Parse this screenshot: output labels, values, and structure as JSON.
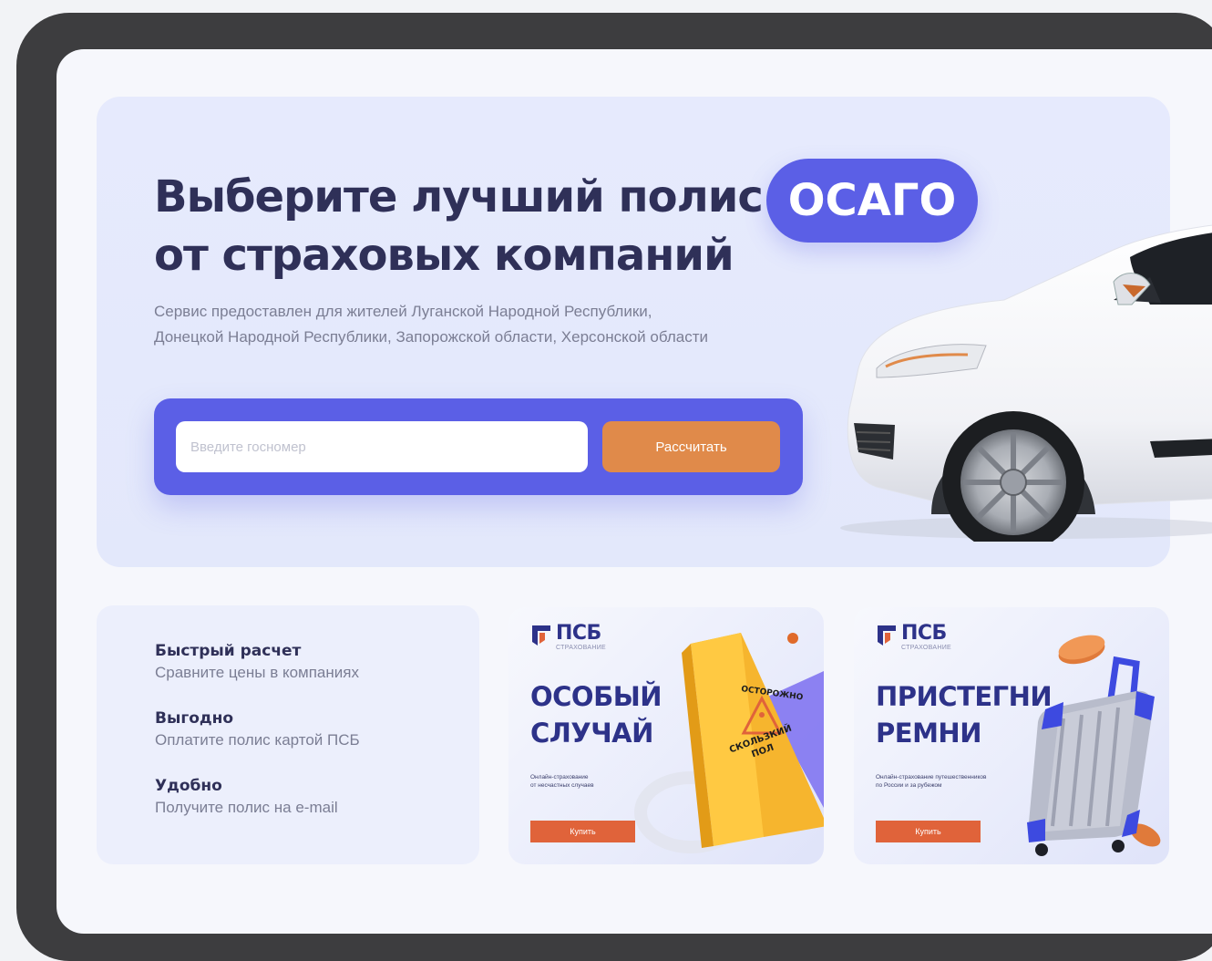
{
  "hero": {
    "title_line1": "Выберите лучший полис",
    "title_line2": "от страховых компаний",
    "badge": "ОСАГО",
    "subtitle_line1": "Сервис предоставлен для жителей Луганской Народной Республики,",
    "subtitle_line2": "Донецкой Народной Республики, Запорожской области, Херсонской области",
    "input_placeholder": "Введите госномер",
    "input_value": "",
    "button_label": "Рассчитать"
  },
  "features": [
    {
      "title": "Быстрый расчет",
      "desc": "Сравните цены в компаниях"
    },
    {
      "title": "Выгодно",
      "desc": "Оплатите полис картой ПСБ"
    },
    {
      "title": "Удобно",
      "desc": "Получите полис на e-mail"
    }
  ],
  "promos": [
    {
      "brand": "ПСБ",
      "brand_sub": "СТРАХОВАНИЕ",
      "headline_line1": "ОСОБЫЙ",
      "headline_line2": "СЛУЧАЙ",
      "note_line1": "Онлайн-страхование",
      "note_line2": "от несчастных случаев",
      "button_label": "Купить",
      "sign_line1": "ОСТОРОЖНО",
      "sign_line2": "СКОЛЬЗКИЙ",
      "sign_line3": "ПОЛ"
    },
    {
      "brand": "ПСБ",
      "brand_sub": "СТРАХОВАНИЕ",
      "headline_line1": "ПРИСТЕГНИ",
      "headline_line2": "РЕМНИ",
      "note_line1": "Онлайн-страхование путешественников",
      "note_line2": "по России и за рубежом",
      "button_label": "Купить"
    }
  ],
  "colors": {
    "accent": "#5b5fe6",
    "cta": "#e08a4a",
    "buy": "#e0633a",
    "brand": "#2d3289",
    "text_dark": "#2f3058",
    "text_muted": "#7b7e94"
  }
}
